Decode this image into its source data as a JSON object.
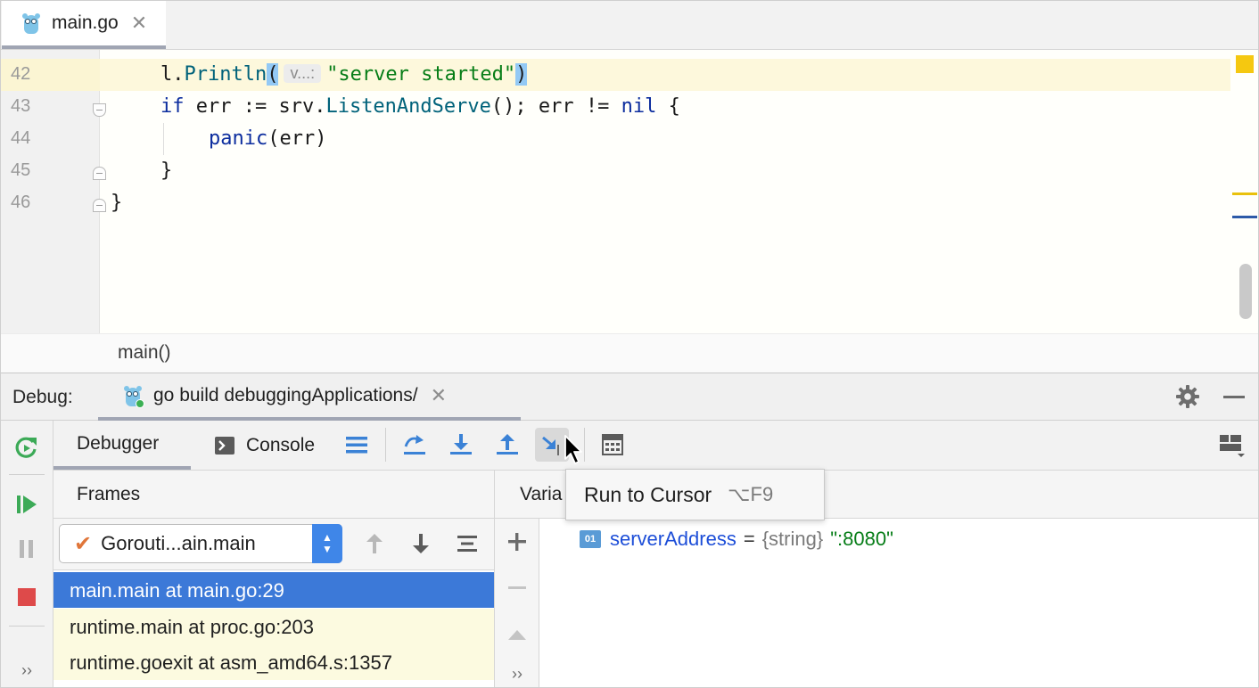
{
  "editor": {
    "tab_label": "main.go",
    "tab_close": "✕",
    "lines": [
      {
        "num": "42"
      },
      {
        "num": "43"
      },
      {
        "num": "44"
      },
      {
        "num": "45"
      },
      {
        "num": "46"
      }
    ],
    "code": {
      "l42_obj": "l.",
      "l42_fn": "Println",
      "l42_open": "(",
      "l42_hint": "v...:",
      "l42_str": "\"server started\"",
      "l42_close": ")",
      "l43_kw": "if",
      "l43_a": " err := srv.",
      "l43_fn": "ListenAndServe",
      "l43_b": "(); err != ",
      "l43_nil": "nil",
      "l43_c": " {",
      "l44_fn": "panic",
      "l44_rest": "(err)",
      "l45": "}",
      "l46": "}"
    },
    "breadcrumb": "main()"
  },
  "debug": {
    "label": "Debug:",
    "run_tab_label": "go build debuggingApplications/",
    "run_tab_close": "✕",
    "tabs": {
      "debugger": "Debugger",
      "console": "Console"
    },
    "tooltip": {
      "text": "Run to Cursor",
      "shortcut": "⌥F9"
    },
    "frames": {
      "header": "Frames",
      "goroutine": "Gorouti...ain.main",
      "rows": [
        "main.main at main.go:29",
        "runtime.main at proc.go:203",
        "runtime.goexit at asm_amd64.s:1357"
      ]
    },
    "variables": {
      "header": "Varia",
      "badge": "01",
      "name": "serverAddress",
      "eq": "=",
      "type": "{string}",
      "value": "\":8080\""
    },
    "more_label": "››"
  },
  "colors": {
    "accent": "#3c79d8",
    "resume_green": "#3caa57",
    "stop_red": "#de4a4a",
    "string_green": "#067d17",
    "keyword_blue": "#0c2d9e"
  }
}
